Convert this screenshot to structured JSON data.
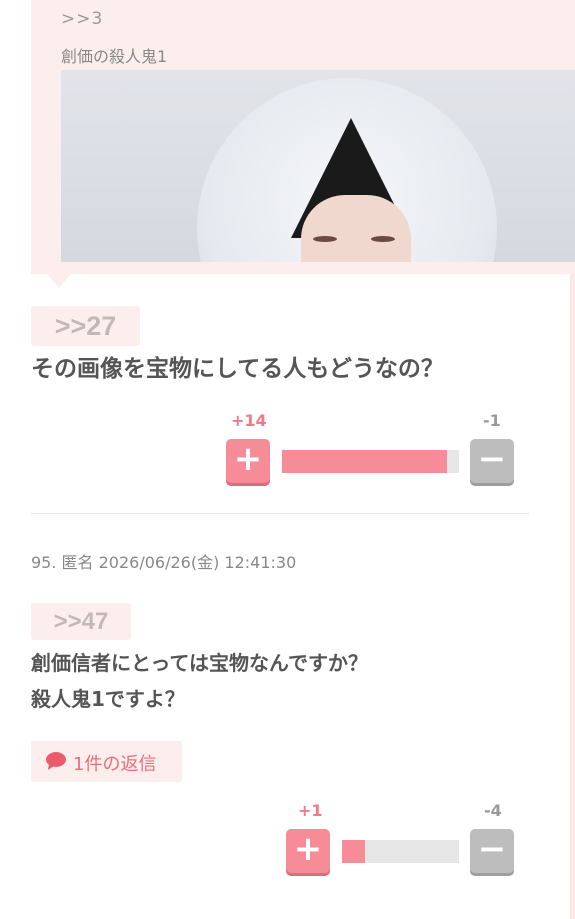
{
  "quoted": {
    "ref": ">>3",
    "text": "創価の殺人鬼1"
  },
  "post1": {
    "anchor": ">>27",
    "text": "その画像を宝物にしてる人もどうなの？",
    "votes": {
      "plus_label": "+14",
      "minus_label": "-1",
      "plus_ratio": 0.93
    }
  },
  "post2": {
    "meta": "95. 匿名 2026/06/26(金) 12:41:30",
    "anchor": ">>47",
    "line1": "創価信者にとっては宝物なんですか？",
    "line2": "殺人鬼1ですよ？",
    "reply_label": "1件の返信",
    "votes": {
      "plus_label": "+1",
      "minus_label": "-4",
      "plus_ratio": 0.2
    }
  },
  "icons": {
    "plus": "+",
    "minus": "−",
    "reply": "speech-bubble-icon"
  },
  "colors": {
    "accent": "#f58c98",
    "badge_bg": "#fdeeee",
    "minus": "#bdbdbd"
  }
}
